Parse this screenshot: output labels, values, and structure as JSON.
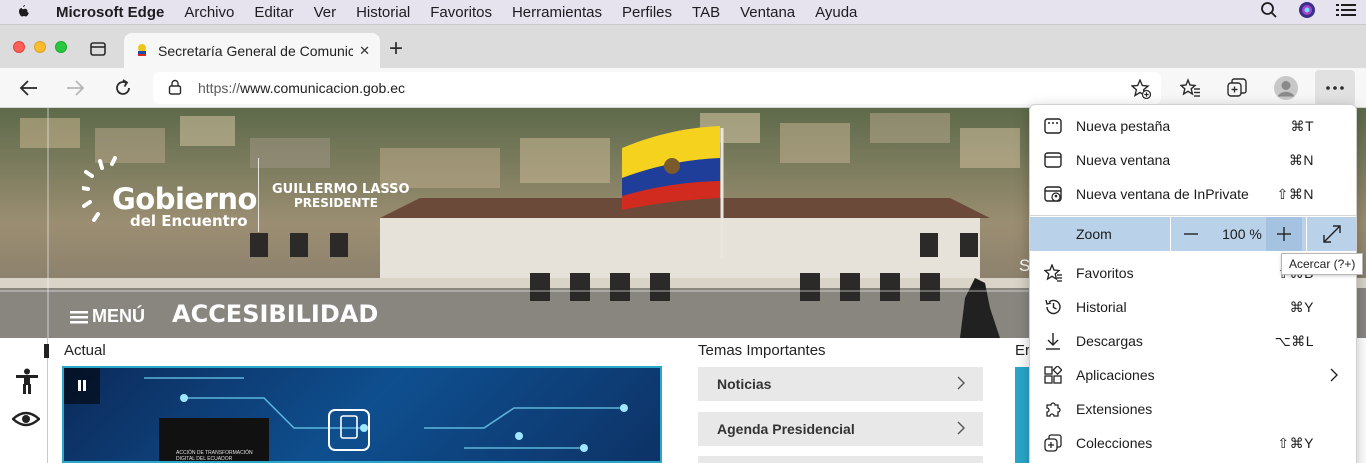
{
  "menubar": {
    "app_name": "Microsoft Edge",
    "items": [
      "Archivo",
      "Editar",
      "Ver",
      "Historial",
      "Favoritos",
      "Herramientas",
      "Perfiles",
      "TAB",
      "Ventana",
      "Ayuda"
    ]
  },
  "tab": {
    "title": "Secretaría General de Comunic",
    "close": "✕",
    "new_tab": "+"
  },
  "toolbar": {
    "url_prefix": "https://",
    "url_domain": "www.comunicacion.gob.ec"
  },
  "hero": {
    "logo_main": "Gobierno",
    "logo_sub": "del Encuentro",
    "president_name": "GUILLERMO LASSO",
    "president_title": "PRESIDENTE",
    "menu_label": "MENÚ",
    "accessibility_label": "ACCESIBILIDAD",
    "partial_text": "S"
  },
  "page": {
    "actual_heading": "Actual",
    "temas_heading": "Temas Importantes",
    "right_heading_partial": "Er",
    "temas_items": [
      {
        "label": "Noticias"
      },
      {
        "label": "Agenda Presidencial"
      }
    ],
    "book_text_1": "ACCIÓN DE TRANSFORMACIÓN",
    "book_text_2": "DIGITAL DEL ECUADOR"
  },
  "context_menu": {
    "items": [
      {
        "label": "Nueva pestaña",
        "shortcut": "⌘T",
        "icon": "new-tab-icon"
      },
      {
        "label": "Nueva ventana",
        "shortcut": "⌘N",
        "icon": "new-window-icon"
      },
      {
        "label": "Nueva ventana de InPrivate",
        "shortcut": "⇧⌘N",
        "icon": "inprivate-icon"
      },
      {
        "label": "Favoritos",
        "shortcut": "⇧⌘B",
        "icon": "favorites-icon"
      },
      {
        "label": "Historial",
        "shortcut": "⌘Y",
        "icon": "history-icon"
      },
      {
        "label": "Descargas",
        "shortcut": "⌥⌘L",
        "icon": "downloads-icon"
      },
      {
        "label": "Aplicaciones",
        "shortcut": "",
        "icon": "apps-icon"
      },
      {
        "label": "Extensiones",
        "shortcut": "",
        "icon": "extensions-icon"
      },
      {
        "label": "Colecciones",
        "shortcut": "⇧⌘Y",
        "icon": "collections-icon"
      }
    ],
    "zoom": {
      "label": "Zoom",
      "value": "100 %",
      "minus": "—",
      "plus": "+"
    },
    "tooltip": "Acercar (?+)"
  },
  "colors": {
    "menubar_bg": "#e6e2ee",
    "zoom_highlight": "#b9d2ea",
    "hero_accent": "#2aa7c9"
  }
}
